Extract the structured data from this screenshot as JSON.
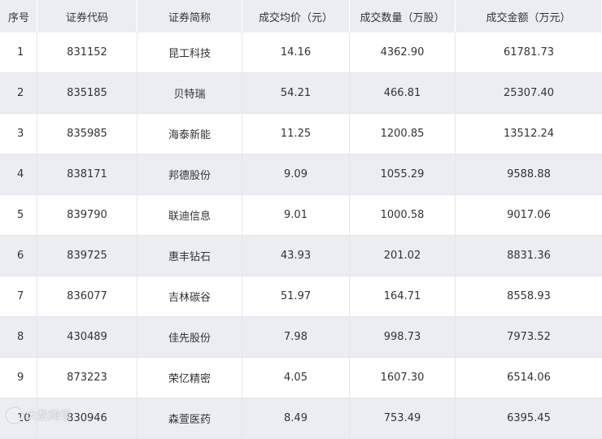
{
  "table": {
    "headers": [
      "序号",
      "证券代码",
      "证券简称",
      "成交均价（元）",
      "成交数量（万股）",
      "成交金额（万元）"
    ],
    "rows": [
      [
        "1",
        "831152",
        "昆工科技",
        "14.16",
        "4362.90",
        "61781.73"
      ],
      [
        "2",
        "835185",
        "贝特瑞",
        "54.21",
        "466.81",
        "25307.40"
      ],
      [
        "3",
        "835985",
        "海泰新能",
        "11.25",
        "1200.85",
        "13512.24"
      ],
      [
        "4",
        "838171",
        "邦德股份",
        "9.09",
        "1055.29",
        "9588.88"
      ],
      [
        "5",
        "839790",
        "联迪信息",
        "9.01",
        "1000.58",
        "9017.06"
      ],
      [
        "6",
        "839725",
        "惠丰钻石",
        "43.93",
        "201.02",
        "8831.36"
      ],
      [
        "7",
        "836077",
        "吉林碳谷",
        "51.97",
        "164.71",
        "8558.93"
      ],
      [
        "8",
        "430489",
        "佳先股份",
        "7.98",
        "998.73",
        "7973.52"
      ],
      [
        "9",
        "873223",
        "荣亿精密",
        "4.05",
        "1607.30",
        "6514.06"
      ],
      [
        "10",
        "830946",
        "森萱医药",
        "8.49",
        "753.49",
        "6395.45"
      ]
    ]
  },
  "watermark": {
    "text": "大数跨境"
  },
  "colors": {
    "header_bg": "#ecedf2",
    "stripe_bg": "#ecedf2",
    "text": "#333333"
  }
}
